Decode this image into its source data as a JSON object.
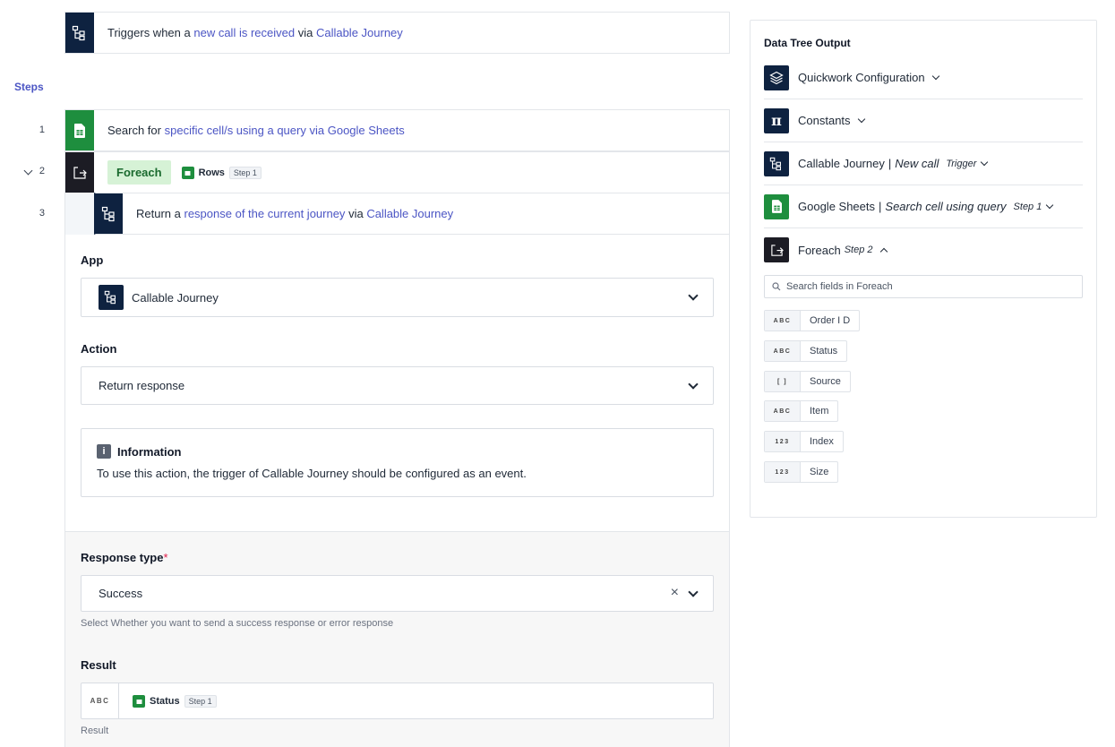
{
  "trigger": {
    "prefix": "Triggers when a",
    "event": "new call is received",
    "via": "via",
    "app": "Callable Journey",
    "icon": "callable-journey-icon"
  },
  "steps_title": "Steps",
  "steps": [
    {
      "number": "1",
      "prefix": "Search for",
      "action": "specific cell/s using a query",
      "via": "via",
      "app": "Google Sheets",
      "icon": "google-sheets-icon"
    },
    {
      "number": "2",
      "badge": "Foreach",
      "chip_label": "Rows",
      "chip_tag": "Step 1",
      "icon": "foreach-icon"
    },
    {
      "number": "3",
      "prefix": "Return a",
      "action": "response of the current journey",
      "via": "via",
      "app": "Callable Journey",
      "icon": "callable-journey-icon"
    }
  ],
  "config": {
    "app_label": "App",
    "app_value": "Callable Journey",
    "action_label": "Action",
    "action_value": "Return response",
    "info_title": "Information",
    "info_text": "To use this action, the trigger of Callable Journey should be configured as an event.",
    "response_type_label": "Response type",
    "required_mark": "*",
    "response_type_value": "Success",
    "response_type_hint": "Select Whether you want to send a success response or error response",
    "result_label": "Result",
    "result_type": "ABC",
    "result_chip_label": "Status",
    "result_chip_tag": "Step 1",
    "result_hint": "Result"
  },
  "data_tree": {
    "title": "Data Tree Output",
    "items": [
      {
        "label": "Quickwork Configuration",
        "icon": "layers-icon"
      },
      {
        "label": "Constants",
        "icon": "pi-icon"
      },
      {
        "label": "Callable Journey",
        "separator": "|",
        "sub": "New call",
        "tag": "Trigger",
        "icon": "callable-journey-icon"
      },
      {
        "label": "Google Sheets",
        "separator": "|",
        "sub": "Search cell using query",
        "tag": "Step 1",
        "icon": "google-sheets-icon"
      },
      {
        "label": "Foreach",
        "tag": "Step 2",
        "icon": "foreach-icon"
      }
    ],
    "search_placeholder": "Search fields in Foreach",
    "fields": [
      {
        "type": "ABC",
        "name": "Order I D"
      },
      {
        "type": "ABC",
        "name": "Status"
      },
      {
        "type": "[ ]",
        "name": "Source"
      },
      {
        "type": "ABC",
        "name": "Item"
      },
      {
        "type": "123",
        "name": "Index"
      },
      {
        "type": "123",
        "name": "Size"
      }
    ]
  },
  "colors": {
    "navy": "#0e2240",
    "sheets_green": "#1e8e3e",
    "link": "#4b55c4",
    "foreach_badge_bg": "#d6f2d6"
  }
}
